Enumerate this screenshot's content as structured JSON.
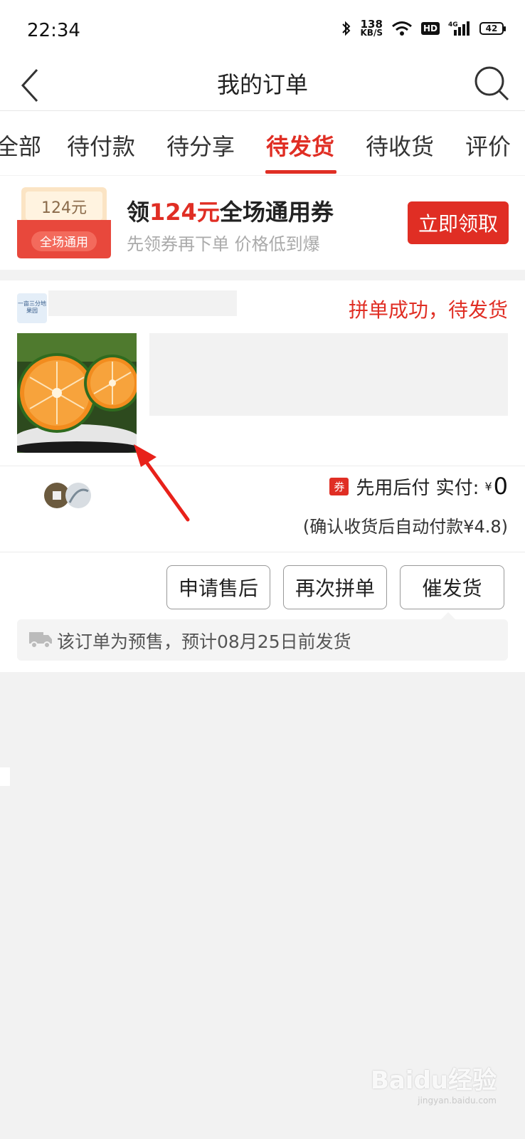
{
  "status_bar": {
    "time": "22:34",
    "net_speed_value": "138",
    "net_speed_unit": "KB/S",
    "hd_label": "HD",
    "signal_label": "4G",
    "battery_level": "42"
  },
  "header": {
    "title": "我的订单"
  },
  "tabs": [
    {
      "label": "全部"
    },
    {
      "label": "待付款"
    },
    {
      "label": "待分享"
    },
    {
      "label": "待发货",
      "active": true
    },
    {
      "label": "待收货"
    },
    {
      "label": "评价"
    }
  ],
  "coupon_banner": {
    "ticket_amount": "124元",
    "ticket_label": "全场通用",
    "title_prefix": "领",
    "title_amount": "124元",
    "title_suffix": "全场通用券",
    "subtitle": "先领券再下单  价格低到爆",
    "button_label": "立即领取"
  },
  "order": {
    "shop_logo_text": "一亩三分地果园",
    "status": "拼单成功，待发货",
    "coupon_tag": "券",
    "pay_label": "先用后付 实付:",
    "currency": "¥",
    "pay_amount": "0",
    "auto_pay_note": "(确认收货后自动付款¥4.8)",
    "buttons": {
      "after_sale": "申请售后",
      "regroup": "再次拼单",
      "urge_ship": "催发货"
    },
    "presale_notice": "该订单为预售，预计08月25日前发货"
  },
  "watermark": {
    "main": "Baidu经验",
    "sub": "jingyan.baidu.com"
  },
  "colors": {
    "accent": "#e02e24",
    "background": "#f2f2f2"
  }
}
